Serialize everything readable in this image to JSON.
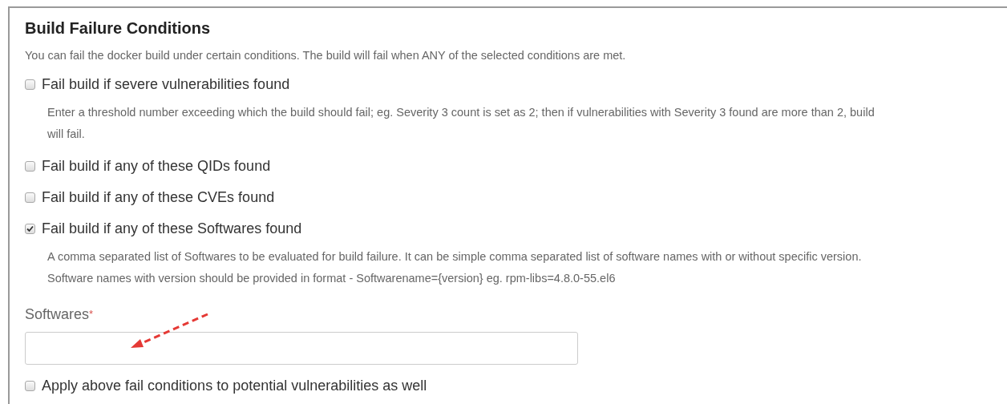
{
  "title": "Build Failure Conditions",
  "description": "You can fail the docker build under certain conditions. The build will fail when ANY of the selected conditions are met.",
  "items": [
    {
      "kind": "checkbox",
      "label": "Fail build if severe vulnerabilities found",
      "checked": false,
      "help": [
        "Enter a threshold number exceeding which the build should fail; eg. Severity 3 count is set as 2; then if vulnerabilities with Severity 3 found are more than 2, build",
        "will fail."
      ]
    },
    {
      "kind": "checkbox",
      "label": "Fail build if any of these QIDs found",
      "checked": false
    },
    {
      "kind": "checkbox",
      "label": "Fail build if any of these CVEs found",
      "checked": false
    },
    {
      "kind": "checkbox",
      "label": "Fail build if any of these Softwares found",
      "checked": true,
      "help": [
        "A comma separated list of Softwares to be evaluated for build failure. It can be simple comma separated list of software names with or without specific version.",
        "Software names with version should be provided in format - Softwarename={version} eg. rpm-libs=4.8.0-55.el6"
      ]
    },
    {
      "kind": "field",
      "label": "Softwares",
      "required_mark": "*"
    },
    {
      "kind": "checkbox",
      "label": "Apply above fail conditions to potential vulnerabilities as well",
      "checked": false
    }
  ]
}
